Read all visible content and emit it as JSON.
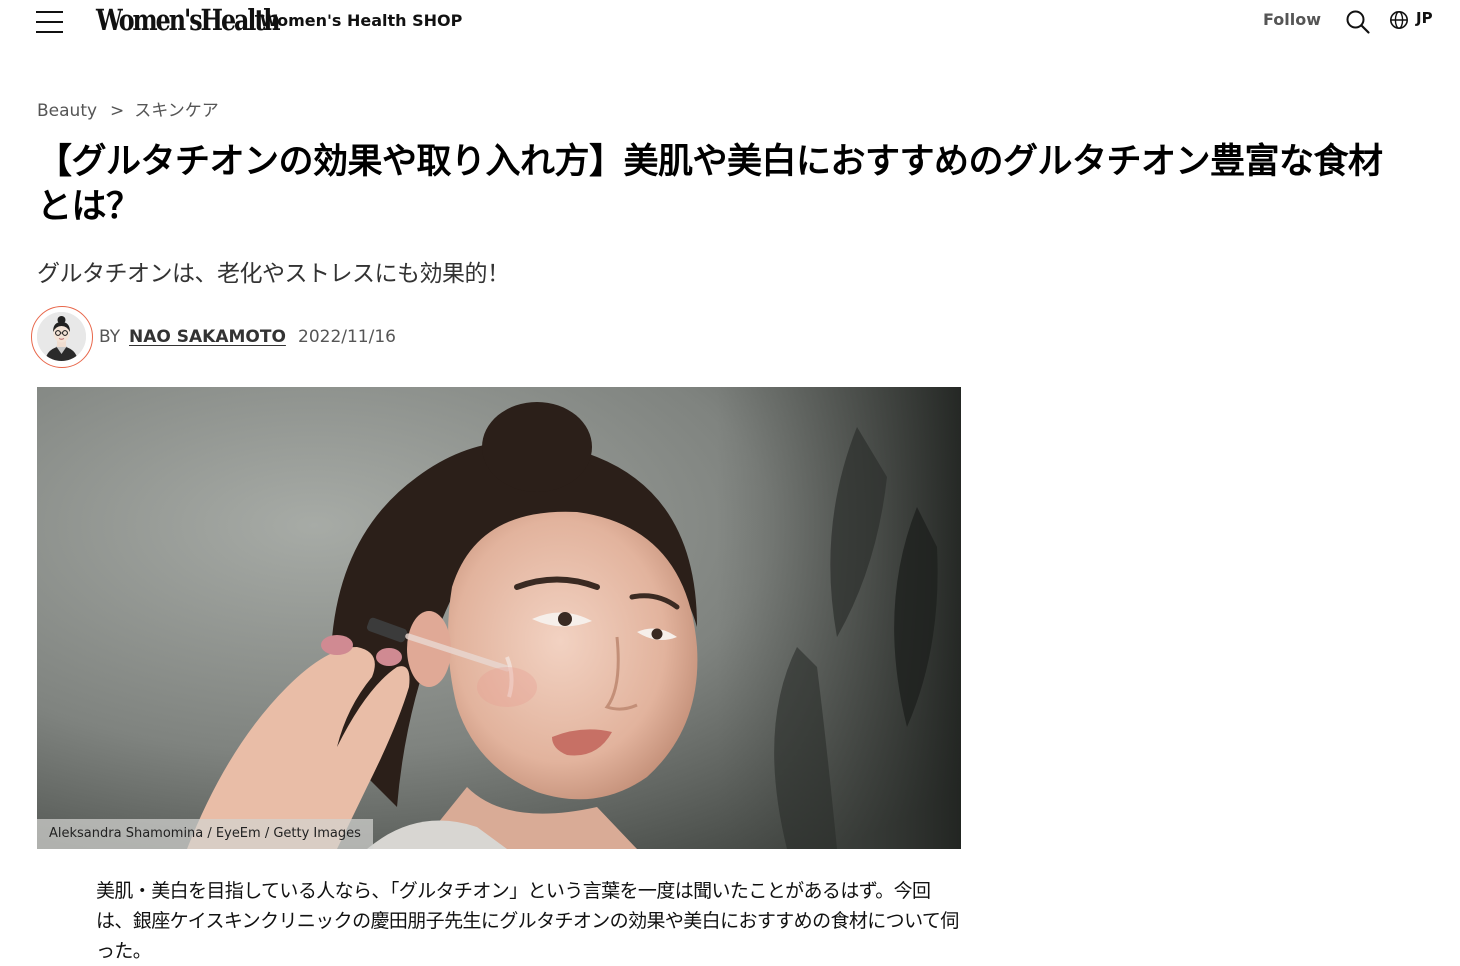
{
  "header": {
    "logo_text": "Women'sHealth",
    "shop_link": "Women's Health SHOP",
    "follow_label": "Follow",
    "region_label": "JP",
    "icons": [
      "menu-icon",
      "search-icon",
      "globe-icon"
    ]
  },
  "breadcrumb": {
    "items": [
      {
        "label": "Beauty"
      },
      {
        "label": "スキンケア"
      }
    ],
    "separator": ">"
  },
  "article": {
    "headline": "【グルタチオンの効果や取り入れ方】美肌や美白におすすめのグルタチオン豊富な食材とは？",
    "dek": "グルタチオンは、老化やストレスにも効果的！",
    "byline": {
      "prefix": "BY",
      "author": "NAO SAKAMOTO",
      "date": "2022/11/16"
    },
    "hero_image": {
      "credit": "Aleksandra Shamomina / EyeEm / Getty Images"
    },
    "body_intro": "美肌・美白を目指している人なら、「グルタチオン」という言葉を一度は聞いたことがあるはず。今回は、銀座ケイスキンクリニックの慶田朋子先生にグルタチオンの効果や美白におすすめの食材について伺った。"
  },
  "colors": {
    "avatar_ring": "#e8674b",
    "text_primary": "#000000",
    "text_muted": "#555555"
  }
}
